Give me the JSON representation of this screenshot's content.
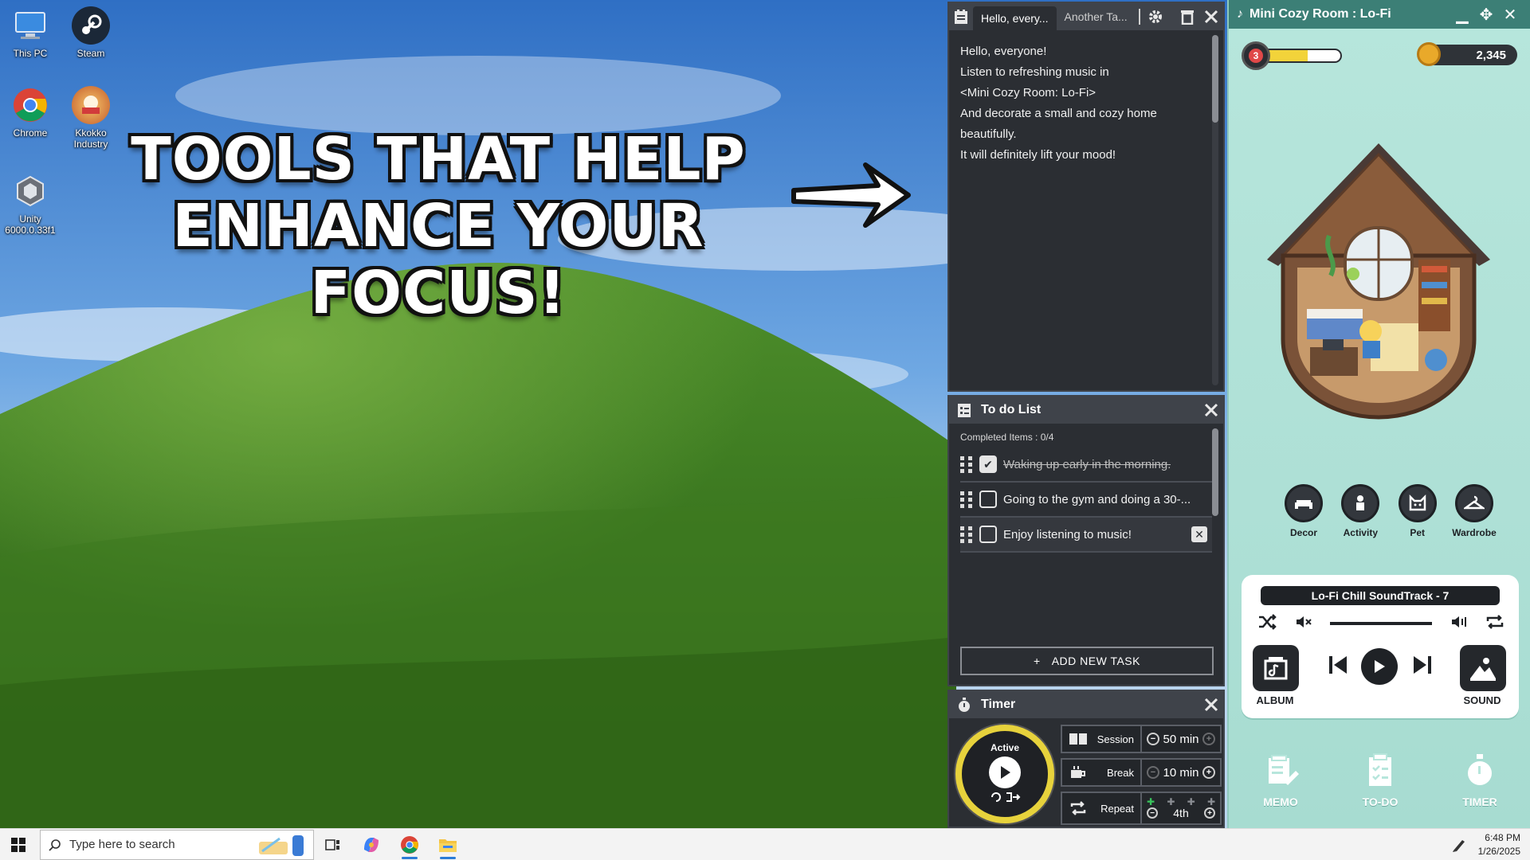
{
  "desktop": {
    "icons": [
      {
        "label": "This PC",
        "icon": "computer-icon"
      },
      {
        "label": "Steam",
        "icon": "steam-icon"
      },
      {
        "label": "Chrome",
        "icon": "chrome-icon"
      },
      {
        "label": "Kkokko Industry",
        "icon": "kkokko-icon"
      },
      {
        "label": "Unity 6000.0.33f1",
        "icon": "unity-icon"
      }
    ],
    "promo_line1": "TOOLS THAT HELP",
    "promo_line2": "ENHANCE YOUR FOCUS!"
  },
  "memo": {
    "tabs": [
      "Hello, every...",
      "Another Ta..."
    ],
    "lines": [
      "Hello, everyone!",
      "Listen to refreshing music in",
      "<Mini Cozy Room: Lo-Fi>",
      "And decorate a small and cozy home",
      "beautifully.",
      "It will definitely lift your mood!"
    ]
  },
  "todo": {
    "title": "To do List",
    "completed": "Completed Items : 0/4",
    "tasks": [
      {
        "text": "Waking up early in the morning.",
        "done": true
      },
      {
        "text": "Going to the gym and doing a 30-...",
        "done": false
      },
      {
        "text": "Enjoy listening to music!",
        "done": false
      }
    ],
    "add_label": "ADD NEW TASK",
    "add_icon": "+"
  },
  "timer": {
    "title": "Timer",
    "status": "Active",
    "session_label": "Session",
    "session_value": "50 min",
    "break_label": "Break",
    "break_value": "10 min",
    "repeat_label": "Repeat",
    "repeat_value": "4th"
  },
  "cozy": {
    "title": "Mini Cozy Room : Lo-Fi",
    "level": "3",
    "xp_fraction": 0.55,
    "coins": "2,345",
    "nav": [
      "Decor",
      "Activity",
      "Pet",
      "Wardrobe"
    ],
    "song": "Lo-Fi Chill SoundTrack - 7",
    "volume_fraction": 1.0,
    "album_label": "ALBUM",
    "sound_label": "SOUND",
    "bottom_nav": [
      "MEMO",
      "TO-DO",
      "TIMER"
    ]
  },
  "taskbar": {
    "search_placeholder": "Type here to search",
    "time": "6:48 PM",
    "date": "1/26/2025"
  },
  "colors": {
    "accent_yellow": "#e7d23c",
    "panel_dark": "#2b2e33",
    "cozy_bg": "#b7e6dc",
    "cozy_bar": "#3c7f76"
  }
}
